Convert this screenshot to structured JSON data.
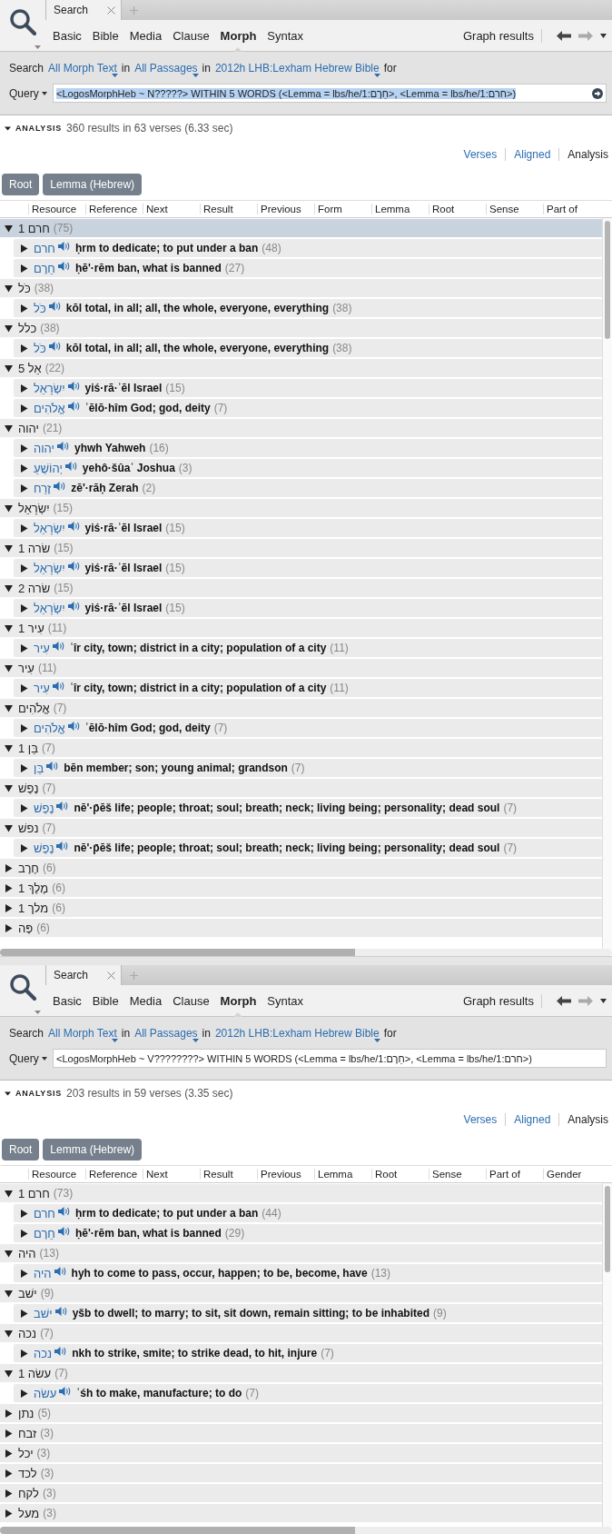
{
  "panels": [
    {
      "tab": {
        "label": "Search"
      },
      "search_types": [
        {
          "label": "Basic",
          "selected": false
        },
        {
          "label": "Bible",
          "selected": false
        },
        {
          "label": "Media",
          "selected": false
        },
        {
          "label": "Clause",
          "selected": false
        },
        {
          "label": "Morph",
          "selected": true
        },
        {
          "label": "Syntax",
          "selected": false
        }
      ],
      "graph_button": "Graph results",
      "search_line": {
        "prefix": "Search",
        "text_scope": "All Morph Text",
        "in_1": "in",
        "passages": "All Passages",
        "in_2": "in",
        "resource": "2012h LHB:Lexham Hebrew Bible",
        "suffix": "for"
      },
      "query": {
        "label": "Query",
        "value": "<LogosMorphHeb ~ N?????> WITHIN 5 WORDS (<Lemma = lbs/he/1:חֵרֶם>, <Lemma = lbs/he/1:חרם>)",
        "focused": true
      },
      "analysis": {
        "label": "ANALYSIS",
        "summary": "360 results in 63 verses (6.33 sec)",
        "expanded": true
      },
      "views": [
        {
          "label": "Verses",
          "selected": false
        },
        {
          "label": "Aligned",
          "selected": false
        },
        {
          "label": "Analysis",
          "selected": true
        }
      ],
      "group_buttons": [
        "Root",
        "Lemma (Hebrew)"
      ],
      "columns": [
        "Resource",
        "Reference",
        "Next",
        "Result",
        "Previous",
        "Form",
        "Lemma",
        "Root",
        "Sense",
        "Part of"
      ],
      "tree": [
        {
          "label": "חרם 1",
          "count": "(75)",
          "expanded": true,
          "selected": true,
          "children": [
            {
              "lemma": "חרם",
              "gloss": "ḥrm to dedicate; to put under a ban",
              "count": "(48)",
              "expanded": false
            },
            {
              "lemma": "חֵרֶם",
              "gloss": "ḥē'·rĕm ban, what is banned",
              "count": "(27)",
              "expanded": false
            }
          ]
        },
        {
          "label": "כֹּל",
          "count": "(38)",
          "expanded": true,
          "selected": false,
          "children": [
            {
              "lemma": "כֹּל",
              "gloss": "kōl total, in all; all, the whole, everyone, everything",
              "count": "(38)",
              "expanded": false
            }
          ]
        },
        {
          "label": "כלל",
          "count": "(38)",
          "expanded": true,
          "selected": false,
          "children": [
            {
              "lemma": "כֹּל",
              "gloss": "kōl total, in all; all, the whole, everyone, everything",
              "count": "(38)",
              "expanded": false
            }
          ]
        },
        {
          "label": "אֵל 5",
          "count": "(22)",
          "expanded": true,
          "selected": false,
          "children": [
            {
              "lemma": "יִשְׂרָאֵל",
              "gloss": "yiś·rā·ʾēl Israel",
              "count": "(15)",
              "expanded": false
            },
            {
              "lemma": "אֱלֹהִים",
              "gloss": "ʾĕlō·hîm God; god, deity",
              "count": "(7)",
              "expanded": false
            }
          ]
        },
        {
          "label": "יהוה",
          "count": "(21)",
          "expanded": true,
          "selected": false,
          "children": [
            {
              "lemma": "יהוה",
              "gloss": "yhwh Yahweh",
              "count": "(16)",
              "expanded": false
            },
            {
              "lemma": "יְהוֹשֻׁעַ",
              "gloss": "yehô·šûaʿ Joshua",
              "count": "(3)",
              "expanded": false
            },
            {
              "lemma": "זֶרַח",
              "gloss": "zĕ'·răḥ Zerah",
              "count": "(2)",
              "expanded": false
            }
          ]
        },
        {
          "label": "יִשְׂרָאֵל",
          "count": "(15)",
          "expanded": true,
          "selected": false,
          "children": [
            {
              "lemma": "יִשְׂרָאֵל",
              "gloss": "yiś·rā·ʾēl Israel",
              "count": "(15)",
              "expanded": false
            }
          ]
        },
        {
          "label": "שׂרה 1",
          "count": "(15)",
          "expanded": true,
          "selected": false,
          "children": [
            {
              "lemma": "יִשְׂרָאֵל",
              "gloss": "yiś·rā·ʾēl Israel",
              "count": "(15)",
              "expanded": false
            }
          ]
        },
        {
          "label": "שׂרה 2",
          "count": "(15)",
          "expanded": true,
          "selected": false,
          "children": [
            {
              "lemma": "יִשְׂרָאֵל",
              "gloss": "yiś·rā·ʾēl Israel",
              "count": "(15)",
              "expanded": false
            }
          ]
        },
        {
          "label": "עִיר 1",
          "count": "(11)",
          "expanded": true,
          "selected": false,
          "children": [
            {
              "lemma": "עִיר",
              "gloss": "ʿîr city, town; district in a city; population of a city",
              "count": "(11)",
              "expanded": false
            }
          ]
        },
        {
          "label": "עִיר",
          "count": "(11)",
          "expanded": true,
          "selected": false,
          "children": [
            {
              "lemma": "עִיר",
              "gloss": "ʿîr city, town; district in a city; population of a city",
              "count": "(11)",
              "expanded": false
            }
          ]
        },
        {
          "label": "אֱלֹהִים",
          "count": "(7)",
          "expanded": true,
          "selected": false,
          "children": [
            {
              "lemma": "אֱלֹהִים",
              "gloss": "ʾĕlō·hîm God; god, deity",
              "count": "(7)",
              "expanded": false
            }
          ]
        },
        {
          "label": "בֵּן 1",
          "count": "(7)",
          "expanded": true,
          "selected": false,
          "children": [
            {
              "lemma": "בֵּן",
              "gloss": "bēn member; son; young animal; grandson",
              "count": "(7)",
              "expanded": false
            }
          ]
        },
        {
          "label": "נֶפֶשׁ",
          "count": "(7)",
          "expanded": true,
          "selected": false,
          "children": [
            {
              "lemma": "נֶפֶשׁ",
              "gloss": "nĕ'·p̄ĕš life; people; throat; soul; breath; neck; living being; personality; dead soul",
              "count": "(7)",
              "expanded": false
            }
          ]
        },
        {
          "label": "נפשׁ",
          "count": "(7)",
          "expanded": true,
          "selected": false,
          "children": [
            {
              "lemma": "נֶפֶשׁ",
              "gloss": "nĕ'·p̄ĕš life; people; throat; soul; breath; neck; living being; personality; dead soul",
              "count": "(7)",
              "expanded": false
            }
          ]
        },
        {
          "label": "חֶרֶב",
          "count": "(6)",
          "expanded": false,
          "selected": false
        },
        {
          "label": "מֶלֶךְ 1",
          "count": "(6)",
          "expanded": false,
          "selected": false
        },
        {
          "label": "מלך 1",
          "count": "(6)",
          "expanded": false,
          "selected": false
        },
        {
          "label": "פֶּה",
          "count": "(6)",
          "expanded": false,
          "selected": false
        }
      ]
    },
    {
      "tab": {
        "label": "Search"
      },
      "search_types": [
        {
          "label": "Basic",
          "selected": false
        },
        {
          "label": "Bible",
          "selected": false
        },
        {
          "label": "Media",
          "selected": false
        },
        {
          "label": "Clause",
          "selected": false
        },
        {
          "label": "Morph",
          "selected": true
        },
        {
          "label": "Syntax",
          "selected": false
        }
      ],
      "graph_button": "Graph results",
      "search_line": {
        "prefix": "Search",
        "text_scope": "All Morph Text",
        "in_1": "in",
        "passages": "All Passages",
        "in_2": "in",
        "resource": "2012h LHB:Lexham Hebrew Bible",
        "suffix": "for"
      },
      "query": {
        "label": "Query",
        "value": "<LogosMorphHeb ~ V????????> WITHIN 5 WORDS (<Lemma = lbs/he/1:חֵרֶם>, <Lemma = lbs/he/1:חרם>)",
        "focused": false
      },
      "analysis": {
        "label": "ANALYSIS",
        "summary": "203 results in 59 verses (3.35 sec)",
        "expanded": true
      },
      "views": [
        {
          "label": "Verses",
          "selected": false
        },
        {
          "label": "Aligned",
          "selected": false
        },
        {
          "label": "Analysis",
          "selected": true
        }
      ],
      "group_buttons": [
        "Root",
        "Lemma (Hebrew)"
      ],
      "columns": [
        "Resource",
        "Reference",
        "Next",
        "Result",
        "Previous",
        "Lemma",
        "Root",
        "Sense",
        "Part of",
        "Gender"
      ],
      "tree": [
        {
          "label": "חרם 1",
          "count": "(73)",
          "expanded": true,
          "selected": false,
          "children": [
            {
              "lemma": "חרם",
              "gloss": "ḥrm to dedicate; to put under a ban",
              "count": "(44)",
              "expanded": false
            },
            {
              "lemma": "חֵרֶם",
              "gloss": "ḥē'·rĕm ban, what is banned",
              "count": "(29)",
              "expanded": false
            }
          ]
        },
        {
          "label": "היה",
          "count": "(13)",
          "expanded": true,
          "selected": false,
          "children": [
            {
              "lemma": "היה",
              "gloss": "hyh to come to pass, occur, happen; to be, become, have",
              "count": "(13)",
              "expanded": false
            }
          ]
        },
        {
          "label": "ישׁב",
          "count": "(9)",
          "expanded": true,
          "selected": false,
          "children": [
            {
              "lemma": "ישׁב",
              "gloss": "yšb to dwell; to marry; to sit, sit down, remain sitting; to be inhabited",
              "count": "(9)",
              "expanded": false
            }
          ]
        },
        {
          "label": "נכה",
          "count": "(7)",
          "expanded": true,
          "selected": false,
          "children": [
            {
              "lemma": "נכה",
              "gloss": "nkh to strike, smite; to strike dead, to hit, injure",
              "count": "(7)",
              "expanded": false
            }
          ]
        },
        {
          "label": "עשׂה 1",
          "count": "(7)",
          "expanded": true,
          "selected": false,
          "children": [
            {
              "lemma": "עשׂה",
              "gloss": "ʿśh to make, manufacture; to do",
              "count": "(7)",
              "expanded": false
            }
          ]
        },
        {
          "label": "נתן",
          "count": "(5)",
          "expanded": false,
          "selected": false
        },
        {
          "label": "זבח",
          "count": "(3)",
          "expanded": false,
          "selected": false
        },
        {
          "label": "יכל",
          "count": "(3)",
          "expanded": false,
          "selected": false
        },
        {
          "label": "לכד",
          "count": "(3)",
          "expanded": false,
          "selected": false
        },
        {
          "label": "לקח",
          "count": "(3)",
          "expanded": false,
          "selected": false
        },
        {
          "label": "מעל",
          "count": "(3)",
          "expanded": false,
          "selected": false
        }
      ]
    }
  ]
}
